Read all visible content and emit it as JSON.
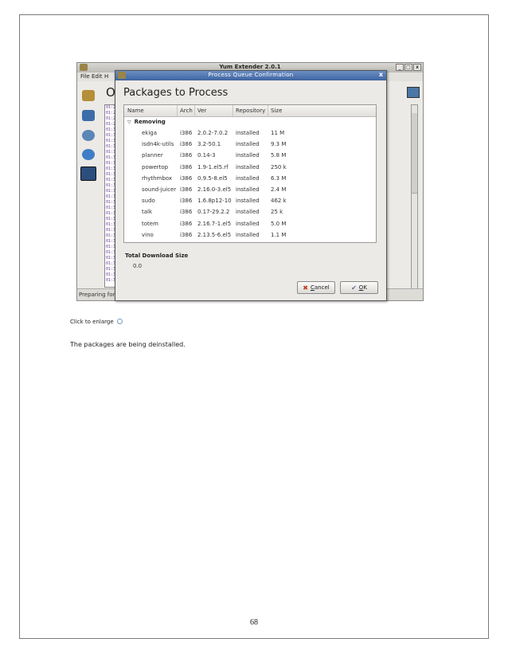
{
  "main_window": {
    "title": "Yum Extender 2.0.1",
    "menus": {
      "file": "File",
      "edit": "Edit",
      "help_partial": "H"
    },
    "section_title_partial": "Ou",
    "status_partial": "Preparing for",
    "log_partial": [
      "01:2",
      "01:2",
      "01:2",
      "01:2",
      "01:3",
      "01:3",
      "01:3",
      "01:3",
      "01:3",
      "01:3",
      "01:3",
      "01:3",
      "01:3",
      "01:3",
      "01:3",
      "01:3",
      "01:3",
      "01:3",
      "01:3",
      "01:3",
      "01:3",
      "01:3",
      "01:3",
      "01:3",
      "01:3",
      "01:3",
      "01:3",
      "01:3",
      "01:3",
      "01:3",
      "01:3",
      "01:3"
    ],
    "window_buttons": {
      "minimize": "_",
      "maximize": "□",
      "close": "x"
    }
  },
  "dialog": {
    "title": "Process Queue Confirmation",
    "close_glyph": "x",
    "heading": "Packages to Process",
    "columns": {
      "name": "Name",
      "arch": "Arch",
      "ver": "Ver",
      "repository": "Repository",
      "size": "Size"
    },
    "group": "Removing",
    "rows": [
      {
        "name": "ekiga",
        "arch": "i386",
        "ver": "2.0.2-7.0.2",
        "repo": "installed",
        "size": "11 M"
      },
      {
        "name": "isdn4k-utils",
        "arch": "i386",
        "ver": "3.2-50.1",
        "repo": "installed",
        "size": "9.3 M"
      },
      {
        "name": "planner",
        "arch": "i386",
        "ver": "0.14-3",
        "repo": "installed",
        "size": "5.8 M"
      },
      {
        "name": "powertop",
        "arch": "i386",
        "ver": "1.9-1.el5.rf",
        "repo": "installed",
        "size": "250 k"
      },
      {
        "name": "rhythmbox",
        "arch": "i386",
        "ver": "0.9.5-8.el5",
        "repo": "installed",
        "size": "6.3 M"
      },
      {
        "name": "sound-juicer",
        "arch": "i386",
        "ver": "2.16.0-3.el5",
        "repo": "installed",
        "size": "2.4 M"
      },
      {
        "name": "sudo",
        "arch": "i386",
        "ver": "1.6.8p12-10",
        "repo": "installed",
        "size": "462 k"
      },
      {
        "name": "talk",
        "arch": "i386",
        "ver": "0.17-29.2.2",
        "repo": "installed",
        "size": "25 k"
      },
      {
        "name": "totem",
        "arch": "i386",
        "ver": "2.16.7-1.el5",
        "repo": "installed",
        "size": "5.0 M"
      },
      {
        "name": "vino",
        "arch": "i386",
        "ver": "2.13.5-6.el5",
        "repo": "installed",
        "size": "1.1 M"
      }
    ],
    "total_label": "Total Download Size",
    "total_value": "0.0",
    "cancel": {
      "access_key": "C",
      "rest": "ancel"
    },
    "ok": {
      "access_key": "O",
      "rest": "K"
    }
  },
  "document": {
    "caption": "Click to enlarge",
    "body": "The packages are being deinstalled.",
    "page_number": "68"
  }
}
